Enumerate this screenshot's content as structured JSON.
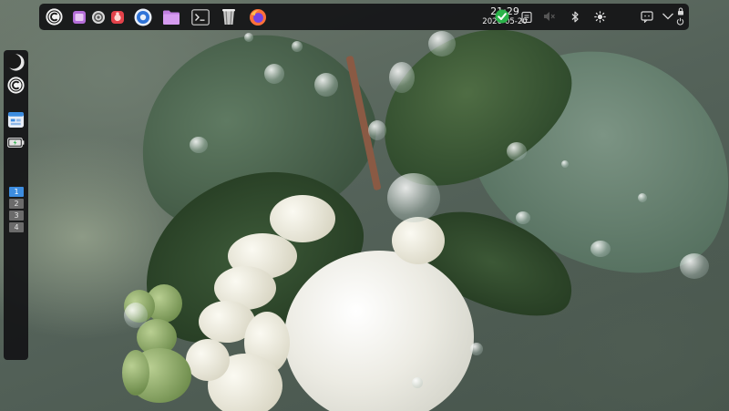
{
  "top_panel": {
    "launchers": [
      {
        "icon": "app-menu-c-logo-icon"
      },
      {
        "icon": "purple-app-icon"
      },
      {
        "icon": "settings-gear-icon"
      },
      {
        "icon": "red-app-icon"
      },
      {
        "icon": "blue-circle-app-icon"
      },
      {
        "icon": "folder-icon"
      },
      {
        "icon": "terminal-icon"
      },
      {
        "icon": "package-manager-icon"
      },
      {
        "icon": "firefox-icon"
      }
    ],
    "clock": {
      "time": "21:29",
      "date": "2026-05-20"
    },
    "tray": [
      {
        "icon": "status-ok-check-icon"
      },
      {
        "icon": "clipboard-icon"
      },
      {
        "icon": "volume-muted-icon"
      },
      {
        "icon": "bluetooth-icon"
      },
      {
        "icon": "brightness-icon"
      },
      {
        "icon": "notifications-icon"
      },
      {
        "icon": "chevron-down-icon"
      },
      {
        "icon": "lock-icon"
      },
      {
        "icon": "power-icon"
      }
    ],
    "colors": {
      "panel": "#141416",
      "ok_green": "#2bb34a",
      "firefox_orange": "#ff7139",
      "folder_purple": "#b46dd8",
      "accent_blue": "#3d8de0"
    }
  },
  "left_panel": {
    "buttons": [
      {
        "icon": "dark-mode-moon-icon"
      },
      {
        "icon": "c-logo-icon"
      },
      {
        "icon": "app-window-icon"
      },
      {
        "icon": "battery-charging-icon"
      }
    ],
    "workspaces": [
      {
        "label": "1",
        "active": true
      },
      {
        "label": "2",
        "active": false
      },
      {
        "label": "3",
        "active": false
      },
      {
        "label": "4",
        "active": false
      }
    ]
  }
}
